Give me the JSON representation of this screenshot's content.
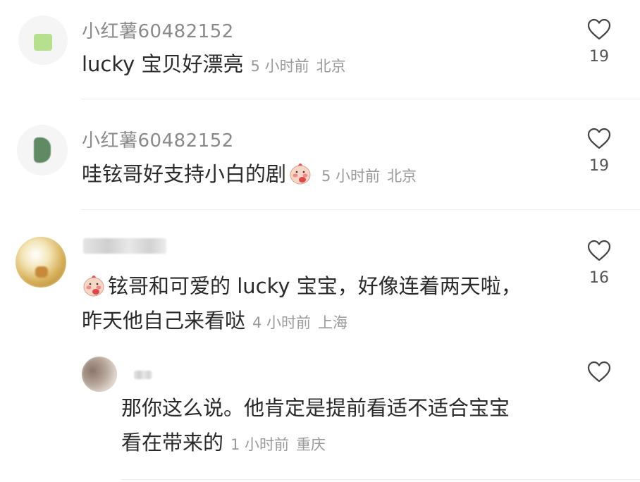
{
  "comments": [
    {
      "username": "小红薯60482152",
      "text": "lucky 宝贝好漂亮",
      "time": "5 小时前",
      "location": "北京",
      "likes": "19"
    },
    {
      "username": "小红薯60482152",
      "text": "哇铉哥好支持小白的剧",
      "time": "5 小时前",
      "location": "北京",
      "likes": "19"
    },
    {
      "username": "",
      "text_line1": "铉哥和可爱的 lucky 宝宝，好像连着两天啦，",
      "text_line2": "昨天他自己来看哒",
      "time": "4 小时前",
      "location": "上海",
      "likes": "16"
    },
    {
      "username": "",
      "text_line1": "那你这么说。他肯定是提前看适不适合宝宝",
      "text_line2": "看在带来的",
      "time": "1 小时前",
      "location": "重庆",
      "likes": ""
    }
  ],
  "icons": {
    "like": "heart-outline-icon",
    "emoji": "shy-face-emoji-icon"
  },
  "colors": {
    "text": "#2a2a2a",
    "meta": "#9a9a9a",
    "username": "#8a8a8a"
  }
}
